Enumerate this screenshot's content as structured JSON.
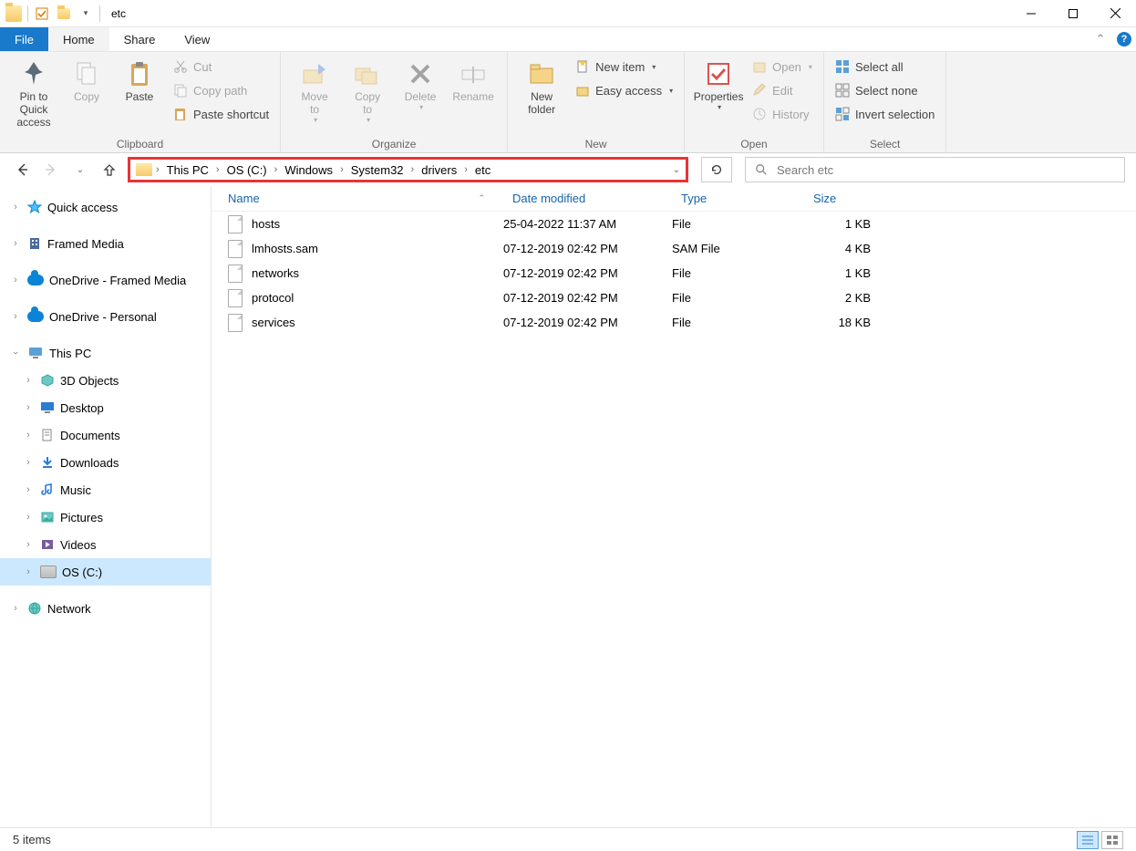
{
  "window": {
    "title": "etc"
  },
  "ribbon": {
    "tabs": {
      "file": "File",
      "home": "Home",
      "share": "Share",
      "view": "View"
    },
    "clipboard": {
      "label": "Clipboard",
      "pin": "Pin to Quick\naccess",
      "copy": "Copy",
      "paste": "Paste",
      "cut": "Cut",
      "copy_path": "Copy path",
      "paste_shortcut": "Paste shortcut"
    },
    "organize": {
      "label": "Organize",
      "move_to": "Move\nto",
      "copy_to": "Copy\nto",
      "delete": "Delete",
      "rename": "Rename"
    },
    "new": {
      "label": "New",
      "new_folder": "New\nfolder",
      "new_item": "New item",
      "easy_access": "Easy access"
    },
    "open": {
      "label": "Open",
      "properties": "Properties",
      "open": "Open",
      "edit": "Edit",
      "history": "History"
    },
    "select": {
      "label": "Select",
      "select_all": "Select all",
      "select_none": "Select none",
      "invert": "Invert selection"
    }
  },
  "breadcrumb": [
    "This PC",
    "OS (C:)",
    "Windows",
    "System32",
    "drivers",
    "etc"
  ],
  "search": {
    "placeholder": "Search etc"
  },
  "sidebar": {
    "quick_access": "Quick access",
    "framed_media": "Framed Media",
    "onedrive_fm": "OneDrive - Framed Media",
    "onedrive_p": "OneDrive - Personal",
    "this_pc": "This PC",
    "pc_children": [
      "3D Objects",
      "Desktop",
      "Documents",
      "Downloads",
      "Music",
      "Pictures",
      "Videos",
      "OS (C:)"
    ],
    "network": "Network"
  },
  "columns": {
    "name": "Name",
    "date": "Date modified",
    "type": "Type",
    "size": "Size"
  },
  "files": [
    {
      "name": "hosts",
      "date": "25-04-2022 11:37 AM",
      "type": "File",
      "size": "1 KB"
    },
    {
      "name": "lmhosts.sam",
      "date": "07-12-2019 02:42 PM",
      "type": "SAM File",
      "size": "4 KB"
    },
    {
      "name": "networks",
      "date": "07-12-2019 02:42 PM",
      "type": "File",
      "size": "1 KB"
    },
    {
      "name": "protocol",
      "date": "07-12-2019 02:42 PM",
      "type": "File",
      "size": "2 KB"
    },
    {
      "name": "services",
      "date": "07-12-2019 02:42 PM",
      "type": "File",
      "size": "18 KB"
    }
  ],
  "status": {
    "count": "5 items"
  }
}
